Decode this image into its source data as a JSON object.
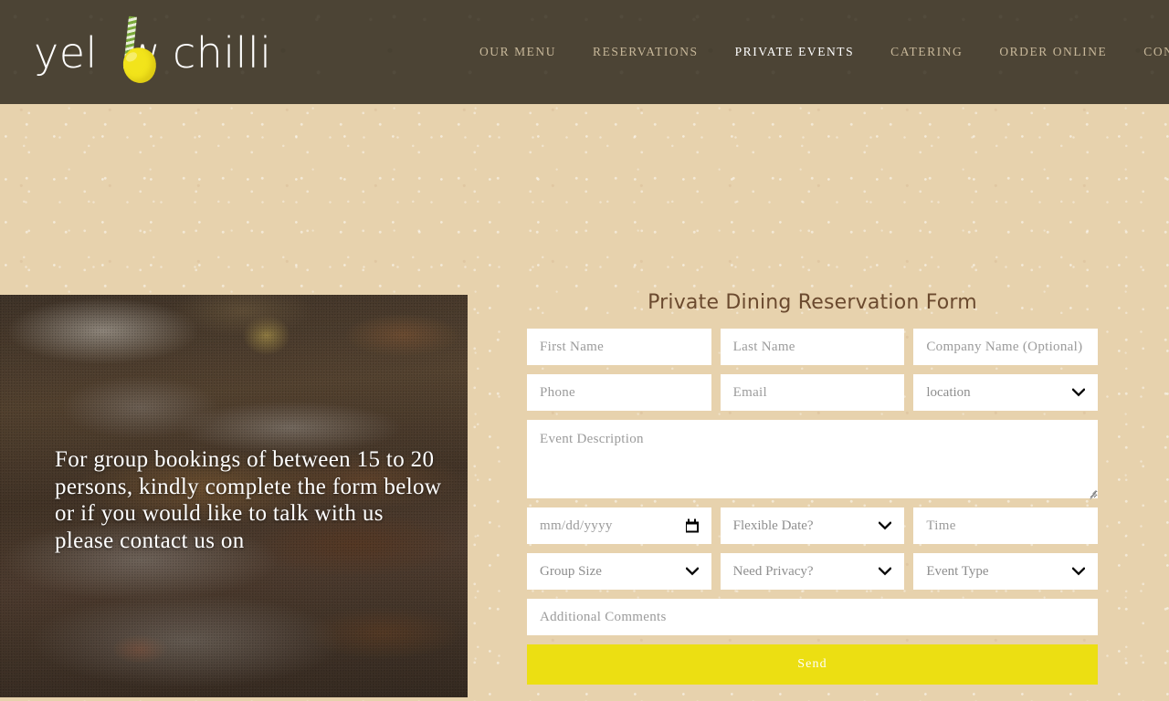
{
  "brand": {
    "logo_text_part1": "yel",
    "logo_text_part2": "w",
    "logo_text_part3": "chilli",
    "logo_alt": "yellow chilli",
    "lemon_color": "#f2e41b",
    "straw_color": "#79a83a"
  },
  "nav": {
    "items": [
      {
        "label": "OUR MENU",
        "active": false
      },
      {
        "label": "RESERVATIONS",
        "active": false
      },
      {
        "label": "PRIVATE EVENTS",
        "active": true
      },
      {
        "label": "CATERING",
        "active": false
      },
      {
        "label": "ORDER ONLINE",
        "active": false
      },
      {
        "label": "CONTACT",
        "active": false
      }
    ],
    "inactive_color": "#c8b89a",
    "active_color": "#ffffff"
  },
  "promo": {
    "text": "For group bookings of between 15 to 20 persons, kindly complete the form below or if you would like to talk with us please contact us on"
  },
  "form": {
    "title": "Private Dining Reservation Form",
    "first_name": {
      "placeholder": "First Name",
      "value": ""
    },
    "last_name": {
      "placeholder": "Last Name",
      "value": ""
    },
    "company_name": {
      "placeholder": "Company Name (Optional)",
      "value": ""
    },
    "phone": {
      "placeholder": "Phone",
      "value": ""
    },
    "email": {
      "placeholder": "Email",
      "value": ""
    },
    "location": {
      "selected": "location",
      "options": [
        "location"
      ]
    },
    "event_description": {
      "placeholder": "Event Description",
      "value": ""
    },
    "event_date": {
      "placeholder": "mm/dd/yyyy",
      "value": ""
    },
    "flexible_date": {
      "selected": "Flexible Date?",
      "options": [
        "Flexible Date?"
      ]
    },
    "event_time": {
      "placeholder": "Time",
      "value": ""
    },
    "group_size": {
      "selected": "Group Size",
      "options": [
        "Group Size"
      ]
    },
    "need_privacy": {
      "selected": "Need Privacy?",
      "options": [
        "Need Privacy?"
      ]
    },
    "event_type": {
      "selected": "Event Type",
      "options": [
        "Event Type"
      ]
    },
    "additional_comments": {
      "placeholder": "Additional Comments",
      "value": ""
    },
    "send_label": "Send",
    "send_color": "#ecdf12"
  },
  "theme": {
    "page_background": "#e7d2ad",
    "header_background": "#4c4435",
    "title_color": "#6b4a2f",
    "field_background": "#ffffff",
    "placeholder_color": "#9b9b9b"
  }
}
